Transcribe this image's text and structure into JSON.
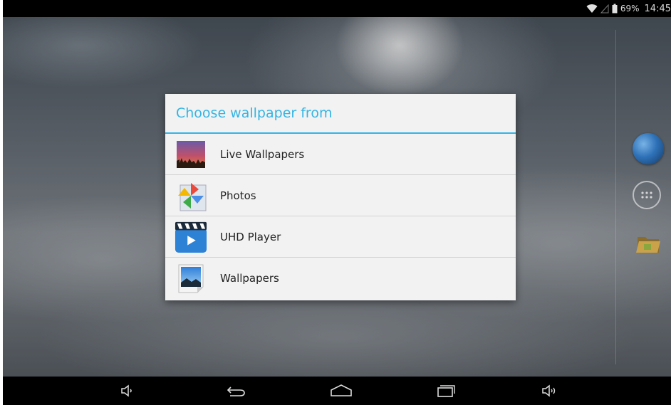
{
  "status_bar": {
    "battery_percent": "69%",
    "time": "14:45"
  },
  "dialog": {
    "title": "Choose wallpaper from",
    "options": [
      {
        "label": "Live Wallpapers",
        "icon": "live-wallpapers-icon"
      },
      {
        "label": "Photos",
        "icon": "photos-pinwheel-icon"
      },
      {
        "label": "UHD Player",
        "icon": "uhd-player-icon"
      },
      {
        "label": "Wallpapers",
        "icon": "wallpapers-icon"
      }
    ]
  },
  "colors": {
    "accent": "#33b5e5",
    "dialog_bg": "#f2f2f2",
    "bar_bg": "#000000"
  },
  "nav_bar": {
    "buttons": [
      "volume-down-icon",
      "back-icon",
      "home-icon",
      "recent-apps-icon",
      "volume-up-icon"
    ]
  }
}
